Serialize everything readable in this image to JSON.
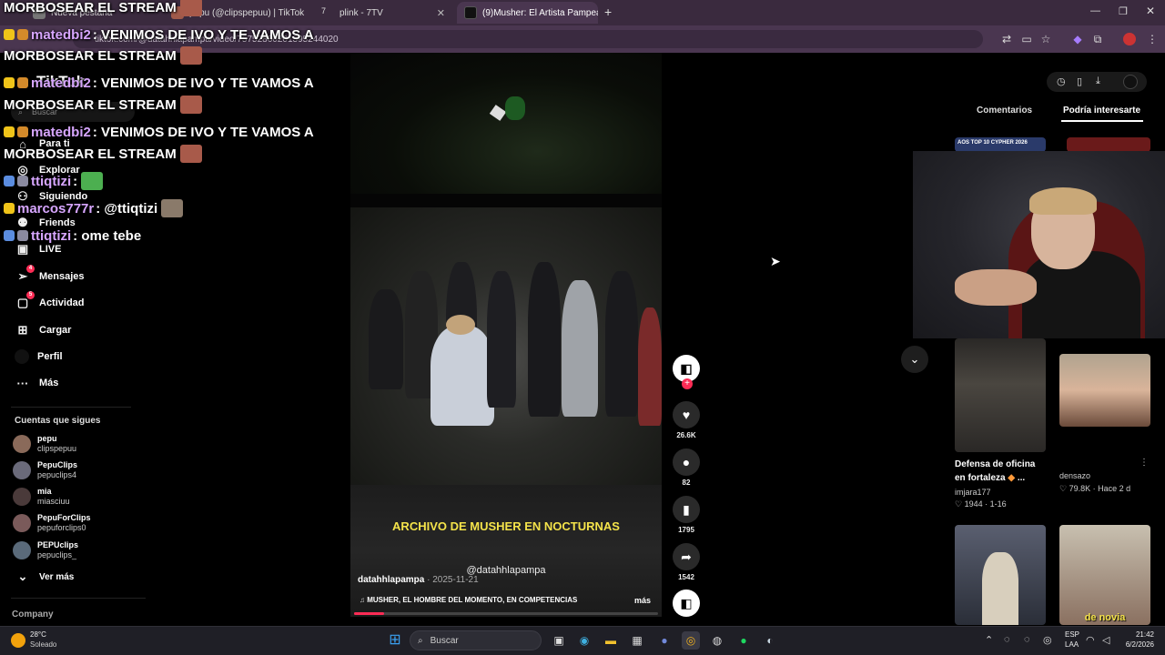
{
  "browser": {
    "tabs": [
      {
        "label": "Nueva pestaña",
        "active": false
      },
      {
        "label": "pepu (@clipspepuu) | TikTok",
        "active": false
      },
      {
        "label": "plink - 7TV",
        "active": false
      },
      {
        "label": "(9)Musher: El Artista Pampeano",
        "active": true
      }
    ],
    "new_tab": "+",
    "url": "tiktok.com/@datahhlapampa/video/75752860201395244020"
  },
  "chat": {
    "lines": [
      {
        "user": "",
        "text": "MORBOSEAR EL STREAM"
      },
      {
        "user": "matedbi2",
        "text": ": VENIMOS DE IVO Y TE VAMOS A"
      },
      {
        "user": "",
        "text": "MORBOSEAR EL STREAM"
      },
      {
        "user": "matedbi2",
        "text": ": VENIMOS DE IVO Y TE VAMOS A"
      },
      {
        "user": "",
        "text": "MORBOSEAR EL STREAM"
      },
      {
        "user": "matedbi2",
        "text": ": VENIMOS DE IVO Y TE VAMOS A"
      },
      {
        "user": "",
        "text": "MORBOSEAR EL STREAM"
      },
      {
        "user": "ttiqtizi",
        "text": ":"
      },
      {
        "user": "marcos777r",
        "text": ": @ttiqtizi"
      },
      {
        "user": "ttiqtizi",
        "text": ": ome tebe"
      }
    ],
    "colors": {
      "user": "#d7a6ff",
      "mark": "#f0c419",
      "emote": "#a85a4a",
      "emote_frog": "#4caf50"
    }
  },
  "sidebar": {
    "logo": "TikTok",
    "search_placeholder": "Buscar",
    "nav": [
      {
        "label": "Para ti",
        "icon": "home-icon"
      },
      {
        "label": "Explorar",
        "icon": "compass-icon"
      },
      {
        "label": "Siguiendo",
        "icon": "following-icon"
      },
      {
        "label": "Friends",
        "icon": "friends-icon"
      },
      {
        "label": "LIVE",
        "icon": "live-icon"
      },
      {
        "label": "Mensajes",
        "icon": "messages-icon",
        "badge": "4"
      },
      {
        "label": "Actividad",
        "icon": "activity-icon",
        "badge": "5"
      },
      {
        "label": "Cargar",
        "icon": "upload-icon"
      },
      {
        "label": "Perfil",
        "icon": "profile-icon"
      },
      {
        "label": "Más",
        "icon": "more-icon"
      }
    ],
    "following_title": "Cuentas que sigues",
    "accounts": [
      {
        "name": "pepu",
        "handle": "clipspepuu"
      },
      {
        "name": "PepuClips",
        "handle": "pepuclips4"
      },
      {
        "name": "mia",
        "handle": "miasciuu"
      },
      {
        "name": "PepuForClips",
        "handle": "pepuforclips0"
      },
      {
        "name": "PEPUclips",
        "handle": "pepuclips_"
      }
    ],
    "see_more": "Ver más",
    "company": "Company"
  },
  "video": {
    "caption": "ARCHIVO DE MUSHER EN NOCTURNAS",
    "watermark": "@datahhlapampa",
    "author": "datahhlapampa",
    "date": "2025-11-21",
    "music": "MUSHER, EL HOMBRE DEL MOMENTO, EN COMPETENCIAS",
    "more": "más",
    "progress": 0.1
  },
  "actions": {
    "likes": "26.6K",
    "comments": "82",
    "saves": "1795",
    "shares": "1542"
  },
  "right_panel": {
    "tabs": [
      "Comentarios",
      "Podría interesarte"
    ],
    "active_tab": "Podría interesarte",
    "thumb_label": "AOS TOP 10 CYPHER 2026",
    "cards": [
      {
        "title": "Defensa de oficina en fortaleza",
        "title_suffix": " ...",
        "author": "imjara177",
        "likes": "1944",
        "date": "1-16"
      },
      {
        "title": "",
        "author": "densazo",
        "likes": "79.8K",
        "date": "Hace 2 d"
      }
    ],
    "bottom_thumb_text": "de novia"
  },
  "taskbar": {
    "weather_temp": "28°C",
    "weather_desc": "Soleado",
    "search_placeholder": "Buscar",
    "lang": "ESP",
    "lang2": "LAA",
    "time": "21:42",
    "date": "6/2/2026"
  }
}
